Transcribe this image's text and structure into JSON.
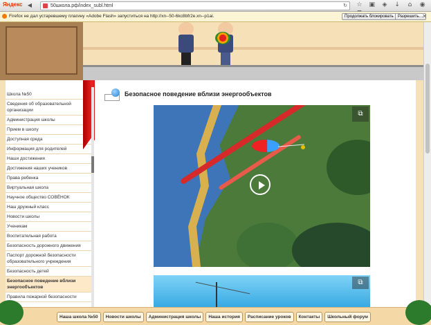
{
  "browser": {
    "logo": "Яндекс",
    "url": "50школа.рф/index_subl.html"
  },
  "notification": {
    "message": "Firefox не дал устаревшему плагину «Adobe Flash» запуститься на http://xn--50-6kc8bfr2e.xn--p1ai.",
    "continue_label": "Продолжать блокировать",
    "allow_label": "Разрешить…"
  },
  "sidebar": {
    "items": [
      {
        "label": "Школа №50"
      },
      {
        "label": "Сведения об образовательной организации"
      },
      {
        "label": "Администрация школы"
      },
      {
        "label": "Прием в школу"
      },
      {
        "label": "Доступная среда"
      },
      {
        "label": "Информация для родителей"
      },
      {
        "label": "Наши достижения"
      },
      {
        "label": "Достижения наших учеников"
      },
      {
        "label": "Права ребенка"
      },
      {
        "label": "Виртуальная школа"
      },
      {
        "label": "Научное общество СОВЁНОК"
      },
      {
        "label": "Наш дружный класс"
      },
      {
        "label": "Новости школы"
      },
      {
        "label": "Ученикам"
      },
      {
        "label": "Воспитательная работа"
      },
      {
        "label": "Безопасность дорожного движения"
      },
      {
        "label": "Паспорт дорожной безопасности образовательного учреждения"
      },
      {
        "label": "Безопасность детей"
      },
      {
        "label": "Безопасное поведение вблизи энергообъектов"
      },
      {
        "label": "Правила пожарной безопасности"
      }
    ],
    "active_index": 18
  },
  "content": {
    "title": "Безопасное поведение вблизи энергообъектов"
  },
  "footer": {
    "links": [
      {
        "label": "Наша школа №50"
      },
      {
        "label": "Новости школы"
      },
      {
        "label": "Администрация школы"
      },
      {
        "label": "Наша история"
      },
      {
        "label": "Расписание уроков"
      },
      {
        "label": "Контакты"
      },
      {
        "label": "Школьный форум"
      }
    ]
  },
  "colors": {
    "accent": "#d62a2a",
    "header_bg": "#f6e0b8",
    "notice_bg": "#fbf5d6"
  }
}
